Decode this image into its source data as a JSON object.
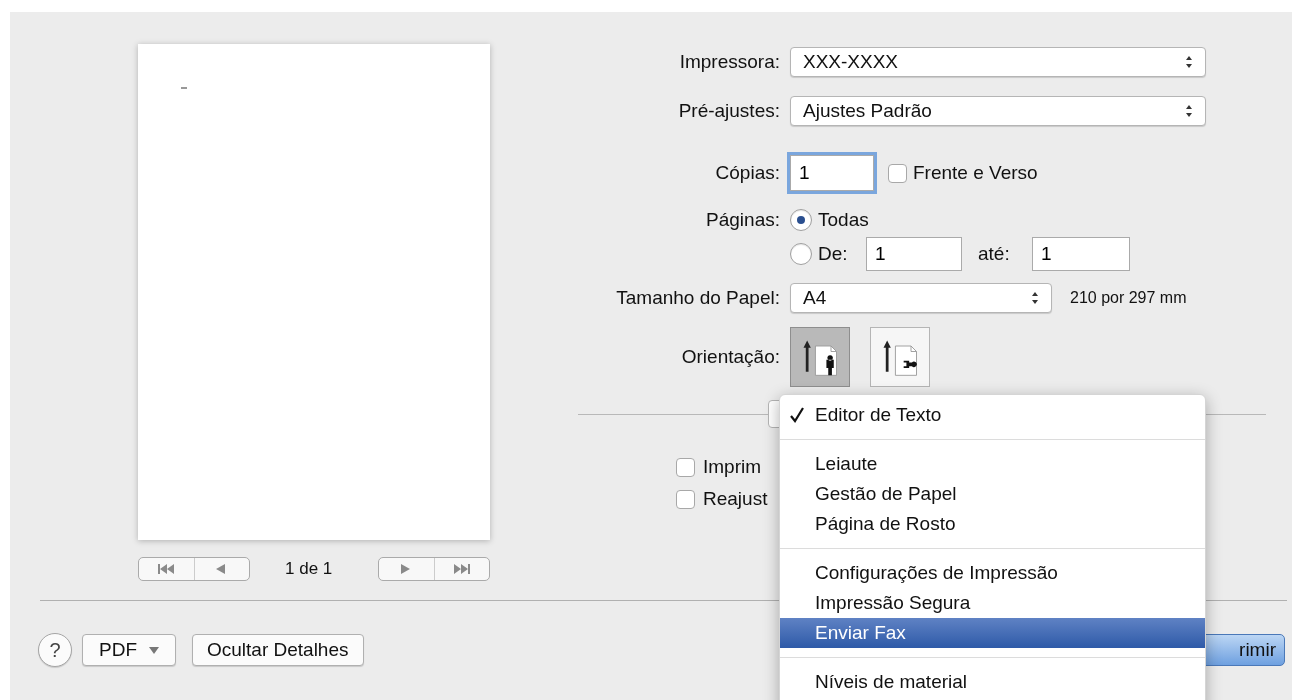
{
  "preview": {
    "page_indicator": "1 de 1"
  },
  "form": {
    "printer": {
      "label": "Impressora:",
      "value": "XXX-XXXX"
    },
    "presets": {
      "label": "Pré-ajustes:",
      "value": "Ajustes Padrão"
    },
    "copies": {
      "label": "Cópias:",
      "value": "1",
      "focused": true,
      "duplex": {
        "label": "Frente e Verso",
        "checked": false
      }
    },
    "pages": {
      "label": "Páginas:",
      "options": [
        {
          "label": "Todas",
          "selected": true
        },
        {
          "label": "De:",
          "selected": false
        }
      ],
      "from": "1",
      "to_label": "até:",
      "to": "1"
    },
    "paper_size": {
      "label": "Tamanho do Papel:",
      "value": "A4",
      "dimensions": "210 por 297 mm"
    },
    "orientation": {
      "label": "Orientação:",
      "options": [
        {
          "kind": "portrait",
          "selected": true
        },
        {
          "kind": "landscape",
          "selected": false
        }
      ]
    },
    "options": [
      {
        "label": "Imprim",
        "checked": false
      },
      {
        "label": "Reajust",
        "checked": false
      }
    ]
  },
  "footer": {
    "buttons": [
      {
        "kind": "help",
        "label": "?"
      },
      {
        "kind": "menu",
        "label": "PDF"
      },
      {
        "kind": "plain",
        "label": "Ocultar Detalhes"
      }
    ],
    "print_button": "rimir"
  },
  "menu": {
    "groups": [
      [
        {
          "label": "Editor de Texto",
          "checked": true,
          "selected": false
        }
      ],
      [
        {
          "label": "Leiaute",
          "checked": false,
          "selected": false
        },
        {
          "label": "Gestão de Papel",
          "checked": false,
          "selected": false
        },
        {
          "label": "Página de Rosto",
          "checked": false,
          "selected": false
        }
      ],
      [
        {
          "label": "Configurações de Impressão",
          "checked": false,
          "selected": false
        },
        {
          "label": "Impressão Segura",
          "checked": false,
          "selected": false
        },
        {
          "label": "Enviar Fax",
          "checked": false,
          "selected": true
        }
      ],
      [
        {
          "label": "Níveis de material",
          "checked": false,
          "selected": false
        }
      ]
    ]
  }
}
